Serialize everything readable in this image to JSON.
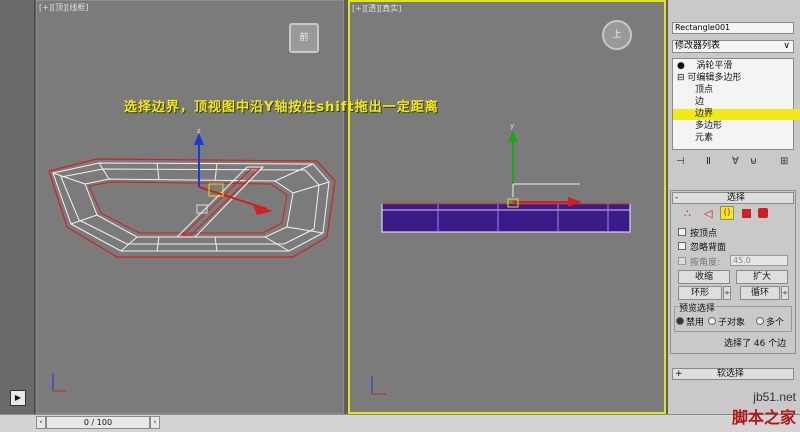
{
  "viewports": {
    "left_label": "[+][顶][线框]",
    "left_cube": "前",
    "right_label": "[+][透][真实]",
    "right_cube": "上"
  },
  "instruction": "选择边界，顶视图中沿Y轴按住shift拖出一定距离",
  "panel": {
    "object_name": "Rectangle001",
    "modifier_list": "修改器列表",
    "stack": {
      "turbosmooth": "涡轮平滑",
      "edit_poly": "可编辑多边形",
      "vertex": "顶点",
      "edge": "边",
      "border": "边界",
      "polygon": "多边形",
      "element": "元素"
    },
    "selection": {
      "title": "选择",
      "by_vertex": "按顶点",
      "ignore_backfacing": "忽略背面",
      "by_angle": "按角度:",
      "angle_value": "45.0",
      "shrink": "收缩",
      "grow": "扩大",
      "ring": "环形",
      "loop": "循环",
      "preview_title": "预览选择",
      "preview_off": "禁用",
      "preview_subobject": "子对象",
      "preview_multi": "多个",
      "status": "选择了 46 个边"
    },
    "soft_selection": "软选择"
  },
  "timeline": {
    "frame": "0 / 100"
  },
  "watermark": {
    "site": "jb51.net",
    "name": "脚本之家"
  },
  "colors": {
    "selection_yellow": "#f1ea16",
    "wire_red": "#d02020",
    "shape_purple": "#3d1a8a",
    "active_border": "#e6e21a"
  }
}
